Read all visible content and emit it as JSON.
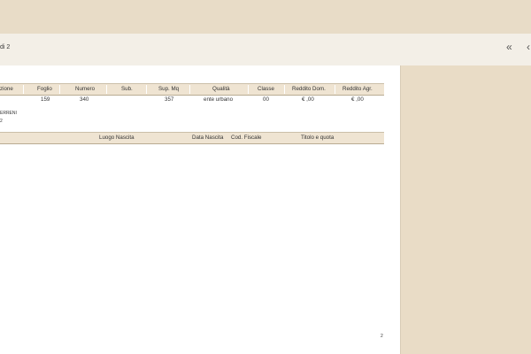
{
  "toolbar": {
    "page_indicator": "di 2",
    "prev_all_icon": "«",
    "prev_icon": "‹"
  },
  "table1": {
    "headers": [
      "zione",
      "Foglio",
      "Numero",
      "Sub.",
      "Sup. Mq",
      "Qualità",
      "Classe",
      "Reddito Dom.",
      "Reddito Agr."
    ],
    "row": [
      "",
      "159",
      "340",
      "",
      "357",
      "ente urbano",
      "00",
      "€ ,00",
      "€ ,00"
    ]
  },
  "notes": {
    "line1": "ERRENI",
    "line2": "2"
  },
  "table2": {
    "headers": [
      "Luogo Nascita",
      "Data Nascita",
      "Cod. Fiscale",
      "Titolo e quota"
    ]
  },
  "footer": {
    "page_number": "2"
  }
}
